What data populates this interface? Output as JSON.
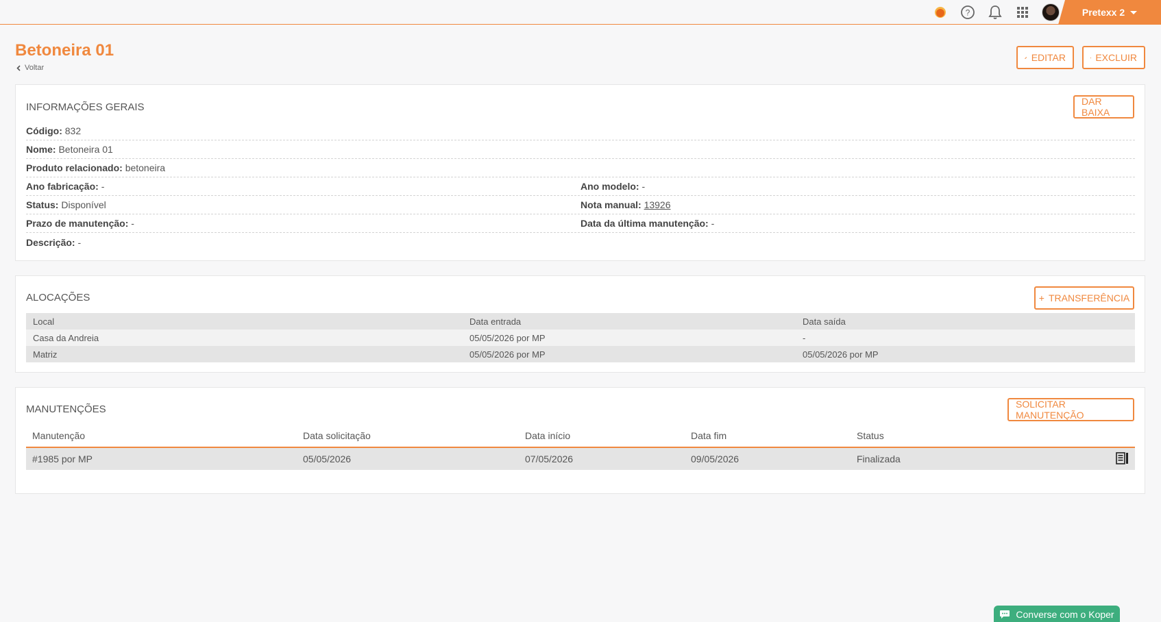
{
  "header": {
    "user_name": "Pretexx 2",
    "icons": [
      "orange-dot-icon",
      "help-icon",
      "bell-icon",
      "apps-grid-icon",
      "avatar"
    ]
  },
  "page": {
    "title": "Betoneira 01",
    "back_label": "Voltar",
    "edit_label": "EDITAR",
    "delete_label": "EXCLUIR"
  },
  "general": {
    "title": "INFORMAÇÕES GERAIS",
    "dar_baixa_label": "DAR BAIXA",
    "codigo_label": "Código:",
    "codigo_value": "832",
    "nome_label": "Nome:",
    "nome_value": "Betoneira 01",
    "produto_label": "Produto relacionado:",
    "produto_value": "betoneira",
    "ano_fab_label": "Ano fabricação:",
    "ano_fab_value": "-",
    "ano_modelo_label": "Ano modelo:",
    "ano_modelo_value": "-",
    "status_label": "Status:",
    "status_value": "Disponível",
    "nota_label": "Nota manual:",
    "nota_value": "13926",
    "prazo_label": "Prazo de manutenção:",
    "prazo_value": "-",
    "ultima_label": "Data da última manutenção:",
    "ultima_value": "-",
    "descricao_label": "Descrição:",
    "descricao_value": "-"
  },
  "allocations": {
    "title": "ALOCAÇÕES",
    "transfer_label": "TRANSFERÊNCIA",
    "columns": [
      "Local",
      "Data entrada",
      "Data saída"
    ],
    "rows": [
      [
        "Casa da Andreia",
        "05/05/2026 por MP",
        "-"
      ],
      [
        "Matriz",
        "05/05/2026 por MP",
        "05/05/2026 por MP"
      ]
    ]
  },
  "maintenance": {
    "title": "MANUTENÇÕES",
    "request_label": "SOLICITAR MANUTENÇÃO",
    "columns": [
      "Manutenção",
      "Data solicitação",
      "Data início",
      "Data fim",
      "Status"
    ],
    "rows": [
      [
        "#1985 por MP",
        "05/05/2026",
        "07/05/2026",
        "09/05/2026",
        "Finalizada"
      ]
    ]
  },
  "chat": {
    "label": "Converse com o Koper"
  },
  "colors": {
    "accent": "#f0883e",
    "chat": "#3dae7e"
  }
}
